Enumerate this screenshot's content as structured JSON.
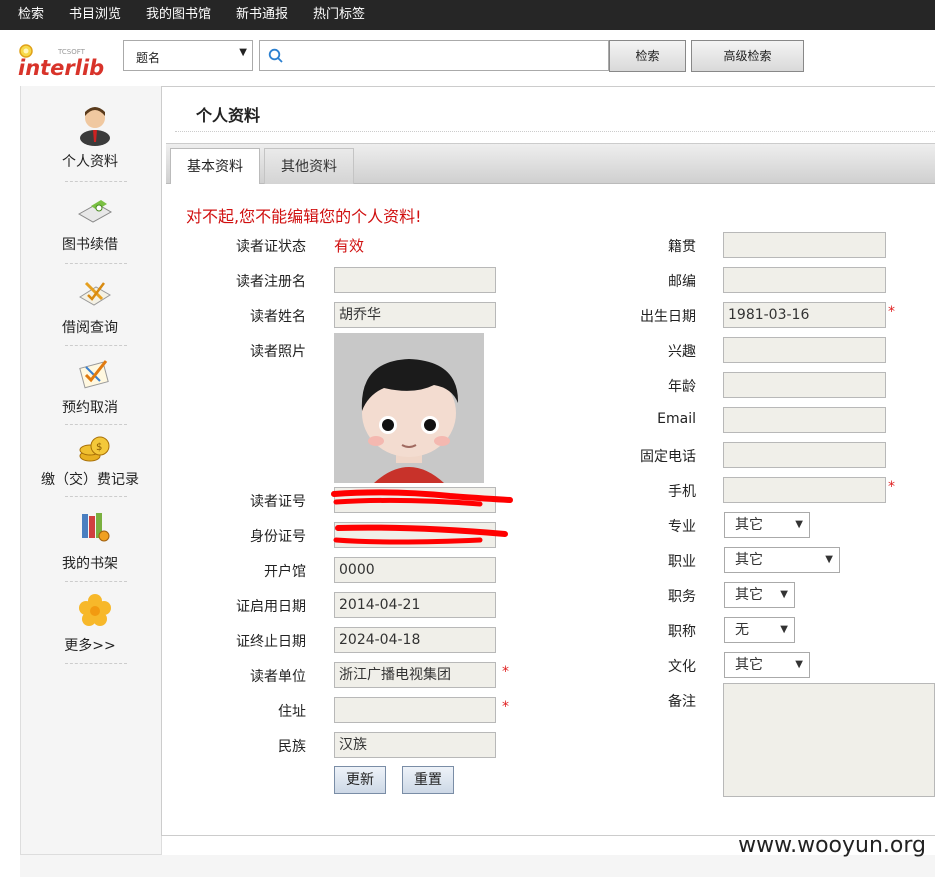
{
  "topnav": {
    "items": [
      "检索",
      "书目浏览",
      "我的图书馆",
      "新书通报",
      "热门标签"
    ]
  },
  "logo": {
    "text": "interlib",
    "small": "TCSOFT"
  },
  "search": {
    "field_value": "题名",
    "search_button": "检索",
    "advanced_button": "高级检索",
    "query": ""
  },
  "sidebar": {
    "items": [
      {
        "label": "个人资料",
        "icon": "user-avatar-icon"
      },
      {
        "label": "图书续借",
        "icon": "renew-book-icon"
      },
      {
        "label": "借阅查询",
        "icon": "borrow-query-icon"
      },
      {
        "label": "预约取消",
        "icon": "reservation-cancel-icon"
      },
      {
        "label": "缴（交）费记录",
        "icon": "coins-icon"
      },
      {
        "label": "我的书架",
        "icon": "bookshelf-icon"
      },
      {
        "label": "更多>>",
        "icon": "flower-icon"
      }
    ]
  },
  "page": {
    "title": "个人资料"
  },
  "tabs": [
    "基本资料",
    "其他资料"
  ],
  "warning": "对不起,您不能编辑您的个人资料!",
  "left": {
    "status_label": "读者证状态",
    "status_value": "有效",
    "regname_label": "读者注册名",
    "regname_value": "",
    "name_label": "读者姓名",
    "name_value": "胡乔华",
    "photo_label": "读者照片",
    "cardno_label": "读者证号",
    "idno_label": "身份证号",
    "branch_label": "开户馆",
    "branch_value": "0000",
    "start_label": "证启用日期",
    "start_value": "2014-04-21",
    "end_label": "证终止日期",
    "end_value": "2024-04-18",
    "unit_label": "读者单位",
    "unit_value": "浙江广播电视集团",
    "address_label": "住址",
    "address_value": "",
    "ethnic_label": "民族",
    "ethnic_value": "汉族",
    "update_button": "更新",
    "reset_button": "重置"
  },
  "right": {
    "native_label": "籍贯",
    "zip_label": "邮编",
    "birth_label": "出生日期",
    "birth_value": "1981-03-16",
    "hobby_label": "兴趣",
    "age_label": "年龄",
    "email_label": "Email",
    "phone_label": "固定电话",
    "mobile_label": "手机",
    "major_label": "专业",
    "major_value": "其它",
    "job_label": "职业",
    "job_value": "其它",
    "duty_label": "职务",
    "duty_value": "其它",
    "rank_label": "职称",
    "rank_value": "无",
    "edu_label": "文化",
    "edu_value": "其它",
    "remarks_label": "备注"
  },
  "required_mark": "*",
  "watermark": "www.wooyun.org",
  "colors": {
    "warning": "#d01010",
    "status": "#d01010",
    "redaction": "#ff0000",
    "topnav": "#262626"
  }
}
